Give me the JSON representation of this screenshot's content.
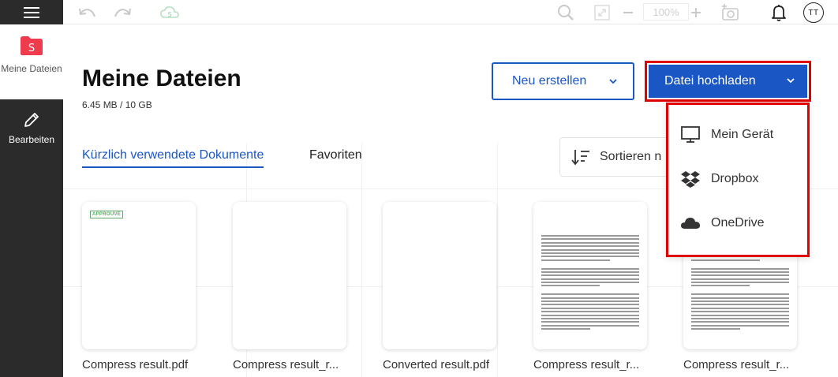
{
  "sidebar": {
    "menu_icon": "hamburger-icon",
    "items": [
      {
        "label": "Meine Dateien",
        "icon": "folder-s-icon",
        "active": true
      },
      {
        "label": "Bearbeiten",
        "icon": "pencil-icon",
        "active": false
      }
    ]
  },
  "toolbar": {
    "zoom_level": "100%",
    "avatar_initials": "TT",
    "icons": [
      "undo-icon",
      "redo-icon",
      "cloud-sync-icon",
      "search-icon",
      "fit-screen-icon",
      "zoom-out-icon",
      "zoom-in-icon",
      "add-image-icon",
      "bell-icon"
    ]
  },
  "header": {
    "title": "Meine Dateien",
    "storage": "6.45 MB / 10 GB",
    "new_button": "Neu erstellen",
    "upload_button": "Datei hochladen"
  },
  "upload_menu": [
    {
      "label": "Mein Gerät",
      "icon": "monitor-icon"
    },
    {
      "label": "Dropbox",
      "icon": "dropbox-icon"
    },
    {
      "label": "OneDrive",
      "icon": "onedrive-icon"
    }
  ],
  "tabs": [
    {
      "label": "Kürzlich verwendete Dokumente",
      "active": true
    },
    {
      "label": "Favoriten",
      "active": false
    }
  ],
  "sort": {
    "label": "Sortieren n"
  },
  "files": [
    {
      "name": "Compress result.pdf",
      "stamp": "APPROUVÉ"
    },
    {
      "name": "Compress result_r..."
    },
    {
      "name": "Converted result.pdf"
    },
    {
      "name": "Compress result_r..."
    },
    {
      "name": "Compress result_r..."
    }
  ],
  "colors": {
    "primary": "#1a56c4",
    "highlight": "#e00000",
    "sidebar": "#2b2b2b",
    "logo": "#ef3b4e"
  }
}
